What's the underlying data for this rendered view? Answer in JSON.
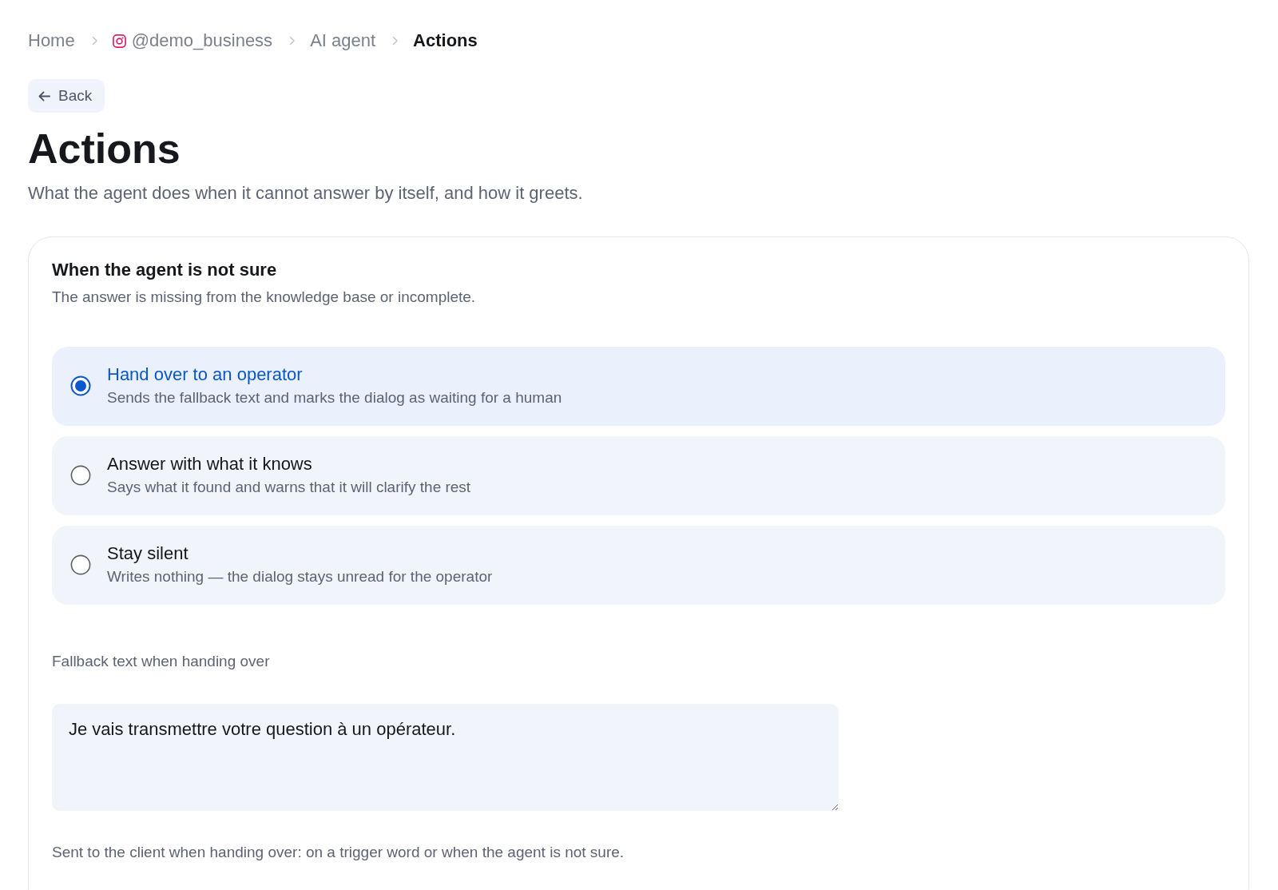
{
  "breadcrumb": [
    {
      "label": "Home",
      "kind": "link"
    },
    {
      "label": "@demo_business",
      "kind": "account"
    },
    {
      "label": "AI agent",
      "kind": "link"
    },
    {
      "label": "Actions",
      "kind": "current"
    }
  ],
  "back_button": {
    "label": "Back"
  },
  "page": {
    "title": "Actions",
    "subtitle": "What the agent does when it cannot answer by itself, and how it greets."
  },
  "section": {
    "title": "When the agent is not sure",
    "description": "The answer is missing from the knowledge base or incomplete.",
    "options": [
      {
        "title": "Hand over to an operator",
        "description": "Sends the fallback text and marks the dialog as waiting for a human",
        "selected": true
      },
      {
        "title": "Answer with what it knows",
        "description": "Says what it found and warns that it will clarify the rest",
        "selected": false
      },
      {
        "title": "Stay silent",
        "description": "Writes nothing — the dialog stays unread for the operator",
        "selected": false
      }
    ],
    "fallback_field": {
      "label": "Fallback text when handing over",
      "value": "Je vais transmettre votre question à un opérateur.",
      "hint": "Sent to the client when handing over: on a trigger word or when the agent is not sure."
    }
  }
}
